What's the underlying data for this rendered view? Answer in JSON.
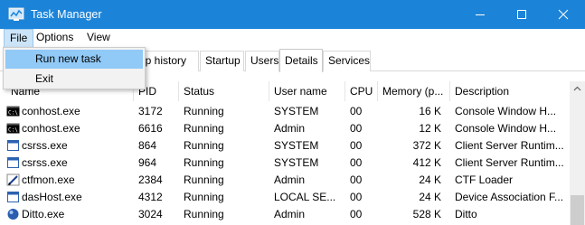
{
  "window": {
    "title": "Task Manager"
  },
  "menubar": {
    "file": "File",
    "options": "Options",
    "view": "View"
  },
  "file_menu": {
    "items": [
      "Run new task",
      "Exit"
    ]
  },
  "tabs": {
    "app_history": "pp history",
    "startup": "Startup",
    "users": "Users",
    "details": "Details",
    "services": "Services",
    "active": "Details"
  },
  "table": {
    "headers": {
      "name": "Name",
      "pid": "PID",
      "status": "Status",
      "user": "User name",
      "cpu": "CPU",
      "memory": "Memory (p...",
      "description": "Description"
    },
    "rows": [
      {
        "icon": "console-icon",
        "name": "conhost.exe",
        "pid": "3172",
        "status": "Running",
        "user": "SYSTEM",
        "cpu": "00",
        "memory": "16 K",
        "description": "Console Window H..."
      },
      {
        "icon": "console-icon",
        "name": "conhost.exe",
        "pid": "6616",
        "status": "Running",
        "user": "Admin",
        "cpu": "00",
        "memory": "12 K",
        "description": "Console Window H..."
      },
      {
        "icon": "window-icon",
        "name": "csrss.exe",
        "pid": "864",
        "status": "Running",
        "user": "SYSTEM",
        "cpu": "00",
        "memory": "372 K",
        "description": "Client Server Runtim..."
      },
      {
        "icon": "window-icon",
        "name": "csrss.exe",
        "pid": "964",
        "status": "Running",
        "user": "SYSTEM",
        "cpu": "00",
        "memory": "412 K",
        "description": "Client Server Runtim..."
      },
      {
        "icon": "pen-icon",
        "name": "ctfmon.exe",
        "pid": "2384",
        "status": "Running",
        "user": "Admin",
        "cpu": "00",
        "memory": "24 K",
        "description": "CTF Loader"
      },
      {
        "icon": "window-icon",
        "name": "dasHost.exe",
        "pid": "4312",
        "status": "Running",
        "user": "LOCAL SE...",
        "cpu": "00",
        "memory": "24 K",
        "description": "Device Association F..."
      },
      {
        "icon": "ditto-icon",
        "name": "Ditto.exe",
        "pid": "3024",
        "status": "Running",
        "user": "Admin",
        "cpu": "00",
        "memory": "528 K",
        "description": "Ditto"
      }
    ]
  },
  "colors": {
    "titlebar": "#1c84d8",
    "menu_highlight": "#91c9f7"
  }
}
